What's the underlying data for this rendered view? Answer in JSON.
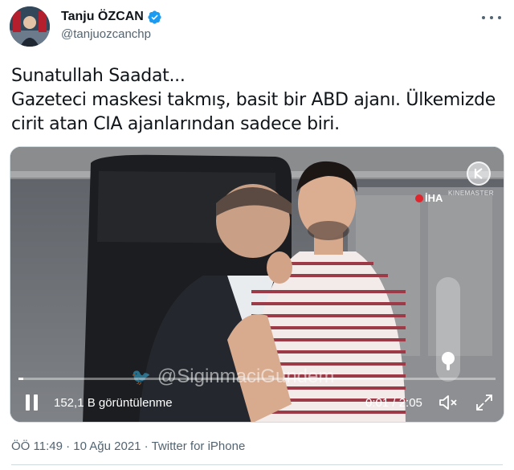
{
  "author": {
    "display_name": "Tanju ÖZCAN",
    "handle": "@tanjuozcanchp",
    "verified": true,
    "avatar_icon": "profile-photo"
  },
  "tweet": {
    "lines": [
      "Sunatullah Saadat...",
      "Gazeteci maskesi takmış, basit bir ABD ajanı. Ülkemizde",
      "cirit atan CIA ajanlarından sadece biri."
    ]
  },
  "video": {
    "watermark": "@SiginmaciGundem",
    "broadcaster_logo": "İHA",
    "editor_brand": "KINEMASTER",
    "views": "152,1 B görüntülenme",
    "time": "0:01 / 2:05",
    "progress": 0.01,
    "volume": 0.15,
    "state": "playing",
    "icons": {
      "pause": "pause-icon",
      "mute": "speaker-muted-icon",
      "fullscreen": "expand-icon"
    }
  },
  "meta": {
    "timestamp": "ÖÖ 11:49 · 10 Ağu 2021 · Twitter for iPhone"
  },
  "colors": {
    "verified_blue": "#1d9bf0",
    "secondary_text": "#536471",
    "primary_text": "#0f1419",
    "iha_red": "#e0262d"
  }
}
